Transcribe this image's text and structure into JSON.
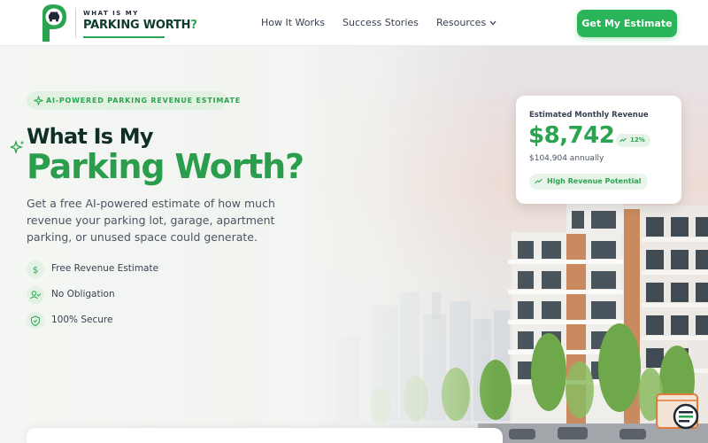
{
  "brand": {
    "small_text": "WHAT IS MY",
    "big_text": "PARKING WORTH",
    "big_text_q": "?",
    "accent": "#2aa44f",
    "dark": "#0f2e24"
  },
  "nav": {
    "items": [
      {
        "label": "How It Works"
      },
      {
        "label": "Success Stories"
      },
      {
        "label": "Resources"
      }
    ],
    "cta": "Get My Estimate"
  },
  "hero": {
    "badge": "AI-POWERED PARKING REVENUE ESTIMATE",
    "title_line1": "What Is My",
    "title_line2": "Parking Worth?",
    "description": "Get a free AI-powered estimate of how much revenue your parking lot, garage, apartment parking, or unused space could generate.",
    "features": [
      {
        "icon": "dollar-icon",
        "label": "Free Revenue Estimate"
      },
      {
        "icon": "user-check-icon",
        "label": "No Obligation"
      },
      {
        "icon": "shield-icon",
        "label": "100% Secure"
      }
    ]
  },
  "card": {
    "label": "Estimated Monthly Revenue",
    "value": "$8,742",
    "change": "12%",
    "annual": "$104,904 annually",
    "tag": "High Revenue Potential"
  }
}
